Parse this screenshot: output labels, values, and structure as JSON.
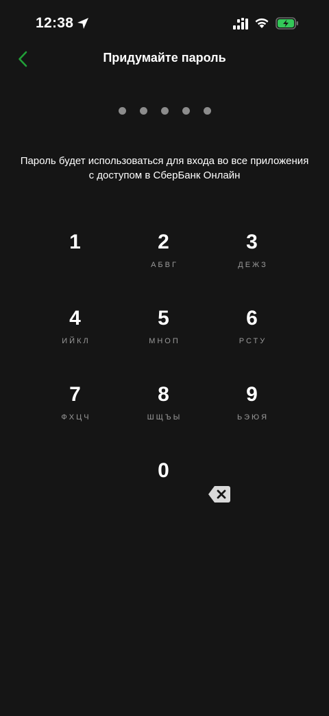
{
  "status_bar": {
    "time": "12:38"
  },
  "header": {
    "title": "Придумайте пароль"
  },
  "pin": {
    "length": 5,
    "filled": 0
  },
  "hint": {
    "line1": "Пароль будет использоваться для входа во все приложения",
    "line2": "с доступом в СберБанк Онлайн"
  },
  "keypad": {
    "keys": [
      {
        "digit": "1",
        "letters": ""
      },
      {
        "digit": "2",
        "letters": "АБВГ"
      },
      {
        "digit": "3",
        "letters": "ДЕЖЗ"
      },
      {
        "digit": "4",
        "letters": "ИЙКЛ"
      },
      {
        "digit": "5",
        "letters": "МНОП"
      },
      {
        "digit": "6",
        "letters": "РСТУ"
      },
      {
        "digit": "7",
        "letters": "ФХЦЧ"
      },
      {
        "digit": "8",
        "letters": "ШЩЪЫ"
      },
      {
        "digit": "9",
        "letters": "ЬЭЮЯ"
      },
      {
        "digit": "0",
        "letters": ""
      }
    ]
  },
  "colors": {
    "background": "#151515",
    "accent": "#21a038",
    "dot": "#8c8c8c",
    "letters": "#9a9a9a",
    "battery_fill": "#34c759"
  },
  "icons": {
    "back": "chevron-left-icon",
    "backspace": "backspace-icon",
    "location": "location-arrow-icon",
    "signal": "cellular-signal-icon",
    "wifi": "wifi-icon",
    "battery": "battery-charging-icon"
  }
}
